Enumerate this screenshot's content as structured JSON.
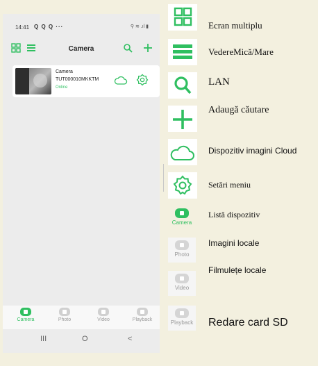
{
  "status_bar": {
    "time": "14:41",
    "notifications": "Q Q Q ···",
    "system": "⚲ ≋ .ıl ▮"
  },
  "app_bar": {
    "title": "Camera"
  },
  "device": {
    "name": "Camera",
    "id": "TUT000010MKKTM",
    "status": "Online"
  },
  "tabs": [
    {
      "label": "Camera",
      "active": true
    },
    {
      "label": "Photo",
      "active": false
    },
    {
      "label": "Video",
      "active": false
    },
    {
      "label": "Playback",
      "active": false
    }
  ],
  "nav": {
    "recent": "III",
    "home": "O",
    "back": "<"
  },
  "legend": {
    "multi_screen": "Ecran multiplu",
    "view_size": "VedereMică/Mare",
    "lan": "LAN",
    "add_search": "Adaugă căutare",
    "cloud": "Dispozitiv imagini Cloud",
    "settings": "Setări meniu",
    "device_list": "Listă dispozitiv",
    "local_images": "Imagini locale",
    "local_videos": "Filmulețe locale",
    "sd_playback": "Redare card SD"
  },
  "legend_tabs": {
    "camera": "Camera",
    "photo": "Photo",
    "video": "Video",
    "playback": "Playback"
  },
  "colors": {
    "accent": "#2fbf60",
    "inactive": "#9a9a9a",
    "background": "#f3f0df"
  },
  "icons": [
    "grid-icon",
    "list-icon",
    "search-icon",
    "plus-icon",
    "cloud-icon",
    "gear-icon",
    "camera-tab-icon",
    "photo-tab-icon",
    "video-tab-icon",
    "playback-tab-icon"
  ]
}
